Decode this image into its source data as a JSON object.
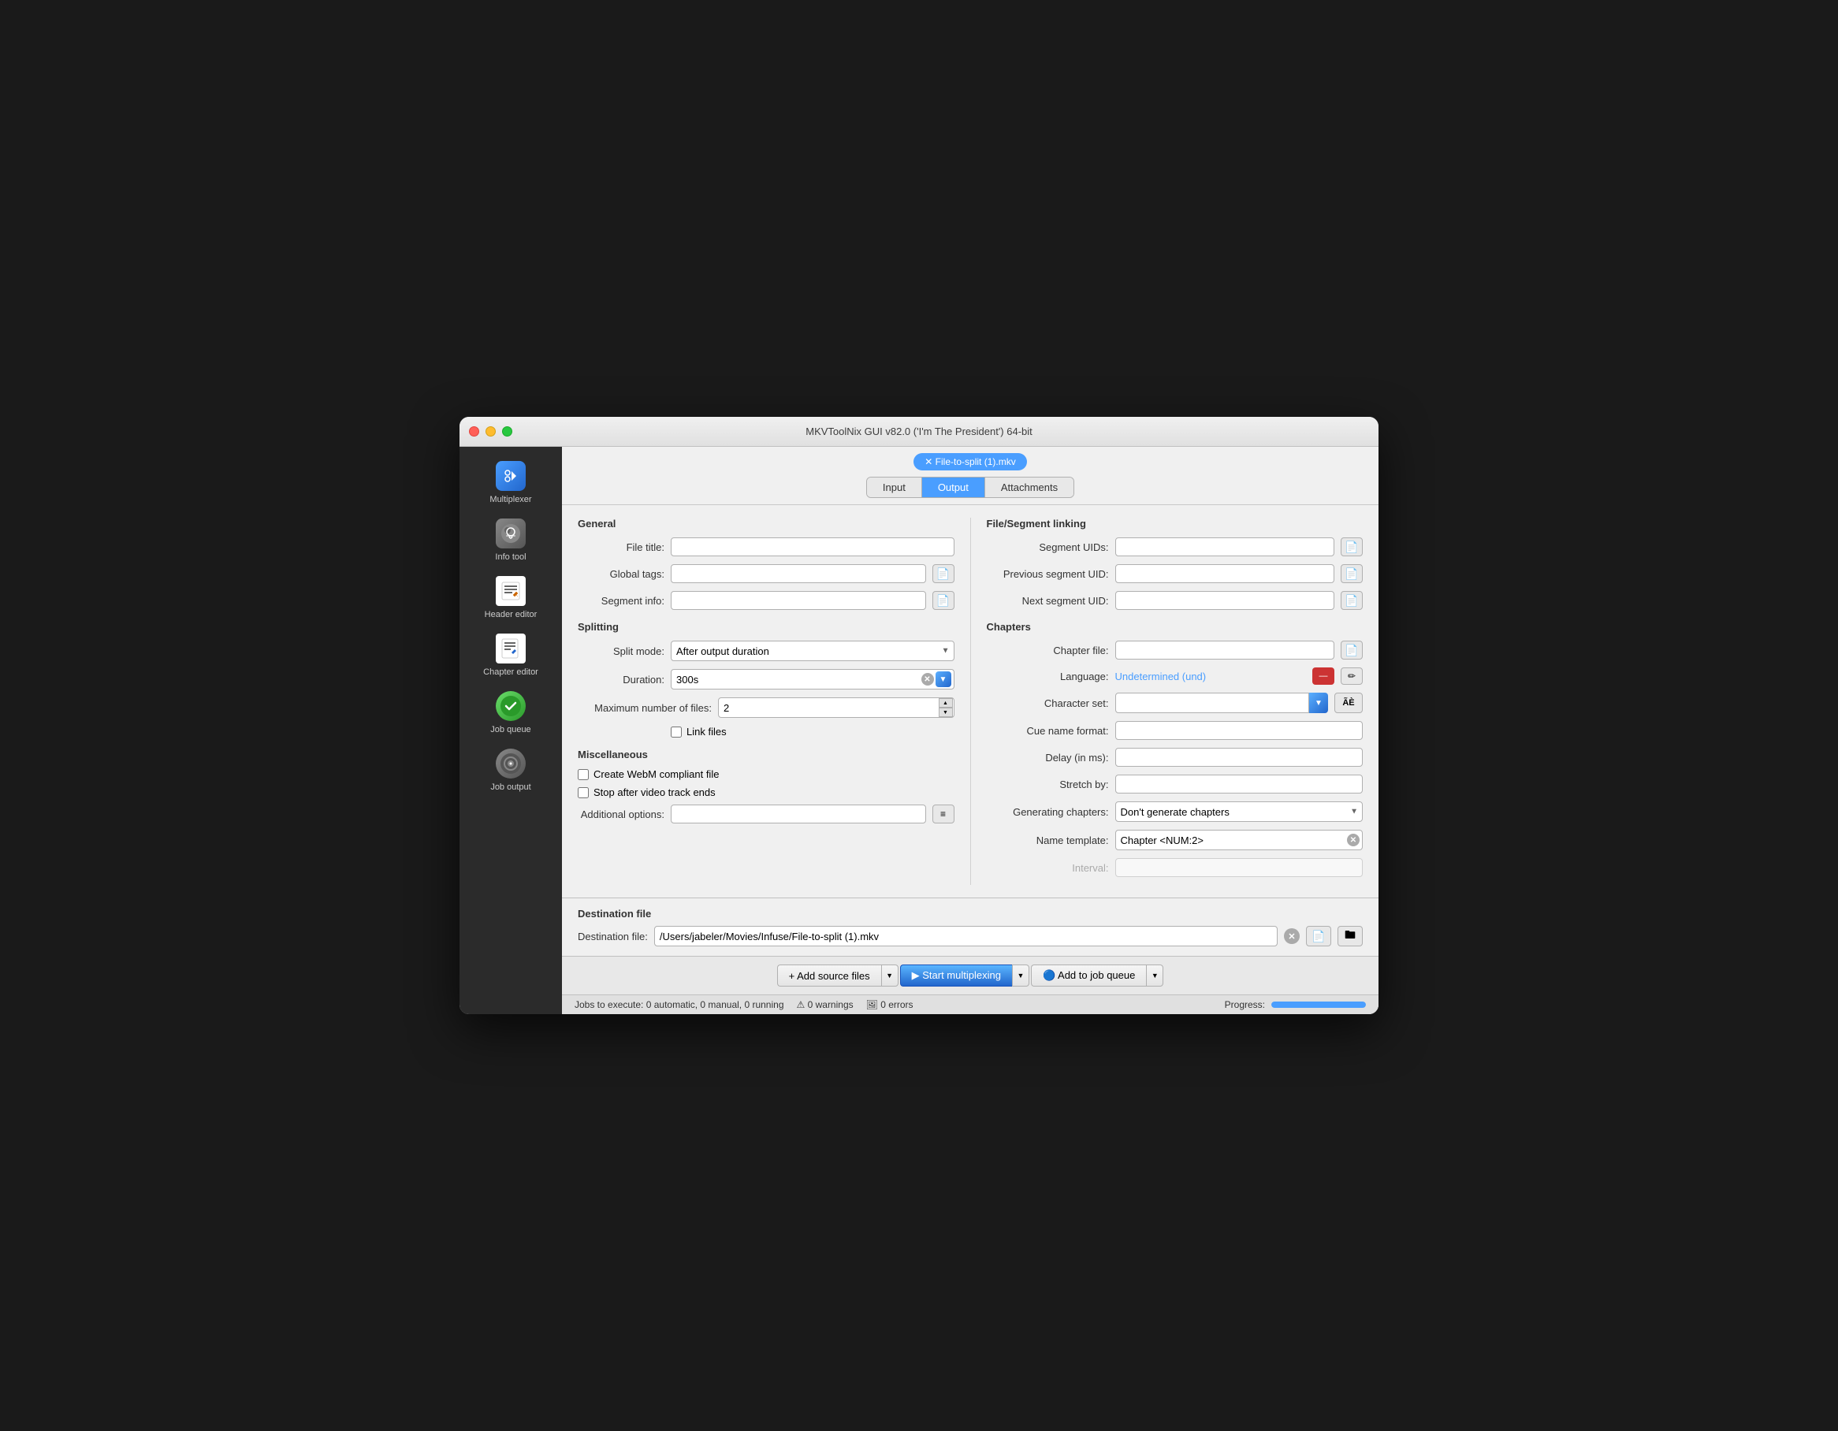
{
  "window": {
    "title": "MKVToolNix GUI v82.0 ('I'm The President') 64-bit"
  },
  "sidebar": {
    "items": [
      {
        "id": "multiplexer",
        "label": "Multiplexer",
        "icon": "⟶"
      },
      {
        "id": "info-tool",
        "label": "Info tool",
        "icon": "🔍"
      },
      {
        "id": "header-editor",
        "label": "Header editor",
        "icon": "✏️"
      },
      {
        "id": "chapter-editor",
        "label": "Chapter editor",
        "icon": "📝"
      },
      {
        "id": "job-queue",
        "label": "Job queue",
        "icon": "✓"
      },
      {
        "id": "job-output",
        "label": "Job output",
        "icon": "⚙"
      }
    ]
  },
  "file_badge": {
    "label": "✕  File-to-split (1).mkv"
  },
  "tabs": {
    "items": [
      "Input",
      "Output",
      "Attachments"
    ],
    "active": "Output"
  },
  "general": {
    "section_title": "General",
    "file_title_label": "File title:",
    "global_tags_label": "Global tags:",
    "segment_info_label": "Segment info:"
  },
  "splitting": {
    "section_title": "Splitting",
    "split_mode_label": "Split mode:",
    "split_mode_value": "After output duration",
    "duration_label": "Duration:",
    "duration_value": "300s",
    "max_files_label": "Maximum number of files:",
    "max_files_value": "2",
    "link_files_label": "Link files"
  },
  "miscellaneous": {
    "section_title": "Miscellaneous",
    "webm_label": "Create WebM compliant file",
    "stop_label": "Stop after video track ends",
    "additional_label": "Additional options:"
  },
  "file_segment_linking": {
    "section_title": "File/Segment linking",
    "segment_uids_label": "Segment UIDs:",
    "prev_segment_label": "Previous segment UID:",
    "next_segment_label": "Next segment UID:"
  },
  "chapters": {
    "section_title": "Chapters",
    "chapter_file_label": "Chapter file:",
    "language_label": "Language:",
    "language_value": "Undetermined (und)",
    "character_set_label": "Character set:",
    "character_set_btn": "ÃÈ",
    "cue_name_label": "Cue name format:",
    "delay_label": "Delay (in ms):",
    "stretch_label": "Stretch by:",
    "generating_label": "Generating chapters:",
    "generating_value": "Don't generate chapters",
    "name_template_label": "Name template:",
    "name_template_value": "Chapter <NUM:2>",
    "interval_label": "Interval:"
  },
  "destination": {
    "section_title": "Destination file",
    "dest_label": "Destination file:",
    "dest_value": "/Users/jabeler/Movies/Infuse/File-to-split (1).mkv"
  },
  "toolbar": {
    "add_source": "+ Add source files",
    "start_mux": "▶ Start multiplexing",
    "add_queue": "🔵 Add to job queue"
  },
  "statusbar": {
    "jobs_text": "Jobs to execute:  0 automatic, 0 manual, 0 running",
    "warnings_text": "⚠ 0 warnings",
    "errors_text": "🖼 0 errors",
    "progress_label": "Progress:",
    "progress_pct": 100
  }
}
